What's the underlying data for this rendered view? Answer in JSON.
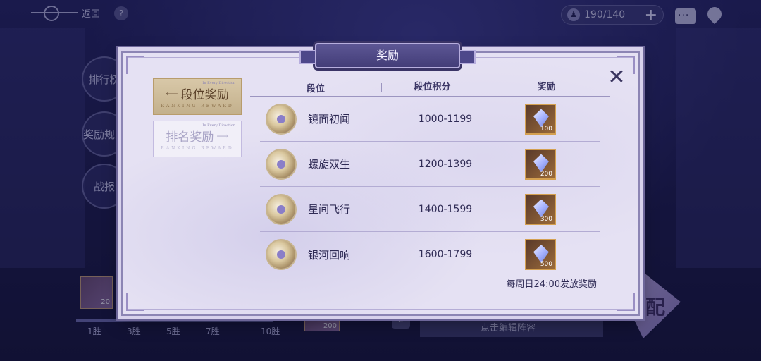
{
  "topbar": {
    "back_label": "返回",
    "help_glyph": "?",
    "stamina_value": "190/140",
    "stamina_add": "+",
    "stamina_pin_glyph": "♟"
  },
  "side_buttons": [
    "排行榜",
    "奖励规则",
    "战报"
  ],
  "bottom": {
    "wins": [
      "1胜",
      "3胜",
      "5胜",
      "7胜",
      "10胜"
    ],
    "chip_qty": "20",
    "chip2_qty": "200",
    "slot_number": "2",
    "deploy_text": "点击编辑阵容",
    "match_label": "配"
  },
  "modal": {
    "title": "奖励",
    "close_glyph": "✕",
    "tabs": [
      {
        "label": "段位奖励",
        "sub": "RANKING REWARD",
        "top": "In Every Direction"
      },
      {
        "label": "排名奖励",
        "sub": "RANKING REWARD",
        "top": "In Every Direction"
      }
    ],
    "headers": {
      "rank": "段位",
      "score": "段位积分",
      "reward": "奖励"
    },
    "rows": [
      {
        "name": "镜面初闻",
        "score": "1000-1199",
        "qty": "100"
      },
      {
        "name": "螺旋双生",
        "score": "1200-1399",
        "qty": "200"
      },
      {
        "name": "星间飞行",
        "score": "1400-1599",
        "qty": "300"
      },
      {
        "name": "银河回响",
        "score": "1600-1799",
        "qty": "500"
      }
    ],
    "footer_note": "每周日24:00发放奖励"
  },
  "colors": {
    "modal_bg": "#e5e1f3",
    "title_plate": "#4d478a",
    "active_tab": "#c3b08c",
    "text": "#2f2b55"
  }
}
